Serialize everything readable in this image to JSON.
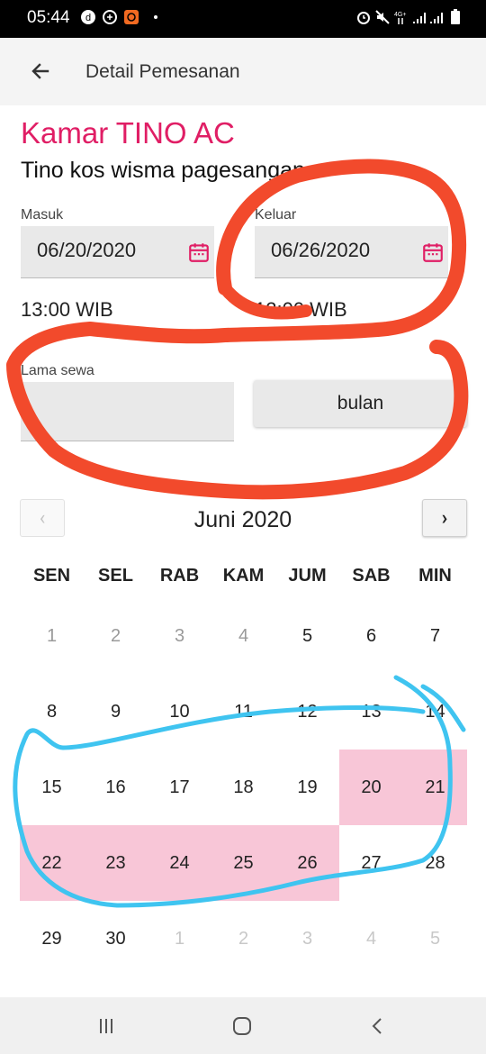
{
  "status_bar": {
    "time": "05:44"
  },
  "app_bar": {
    "title": "Detail Pemesanan"
  },
  "room": {
    "title": "Kamar TINO AC",
    "subtitle": "Tino kos wisma pagesangan"
  },
  "check_in": {
    "label": "Masuk",
    "date": "06/20/2020",
    "time": "13:00 WIB"
  },
  "check_out": {
    "label": "Keluar",
    "date": "06/26/2020",
    "time": "12:00 WIB"
  },
  "duration": {
    "label": "Lama sewa",
    "value": "",
    "unit_button": "bulan"
  },
  "calendar": {
    "month": "Juni 2020",
    "prev_label": "‹",
    "next_label": "›",
    "weekdays": [
      "SEN",
      "SEL",
      "RAB",
      "KAM",
      "JUM",
      "SAB",
      "MIN"
    ],
    "weeks": [
      [
        "1",
        "2",
        "3",
        "4",
        "5",
        "6",
        "7"
      ],
      [
        "8",
        "9",
        "10",
        "11",
        "12",
        "13",
        "14"
      ],
      [
        "15",
        "16",
        "17",
        "18",
        "19",
        "20",
        "21"
      ],
      [
        "22",
        "23",
        "24",
        "25",
        "26",
        "27",
        "28"
      ],
      [
        "29",
        "30",
        "1",
        "2",
        "3",
        "4",
        "5"
      ]
    ],
    "selected_days": [
      "20",
      "21",
      "22",
      "23",
      "24",
      "25",
      "26"
    ]
  },
  "colors": {
    "accent": "#e01e65",
    "selected": "#f8c6d7",
    "annotation_red": "#f24a2c",
    "annotation_blue": "#3fc4f0"
  }
}
